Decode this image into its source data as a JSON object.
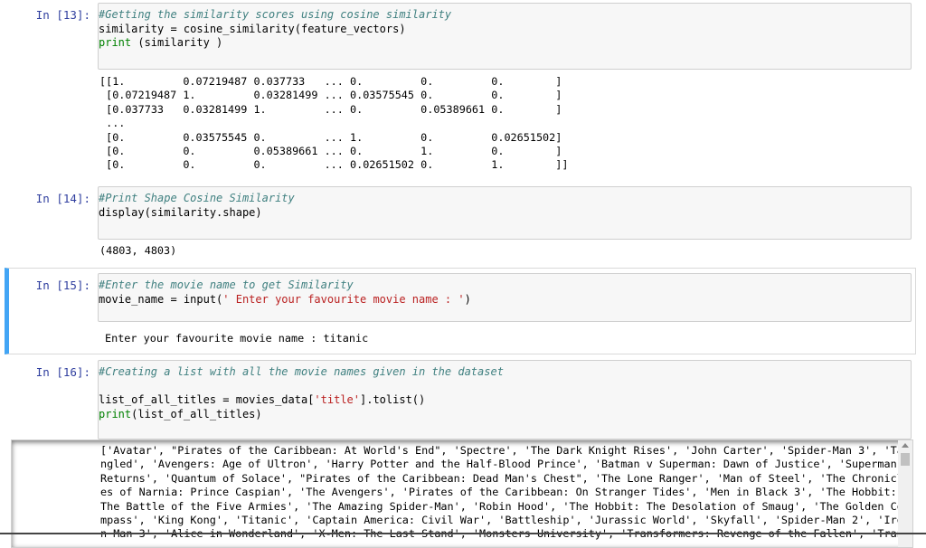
{
  "cells": [
    {
      "prompt": "In [13]:",
      "comment": "#Getting the similarity scores using cosine similarity",
      "line2": "similarity = cosine_similarity(feature_vectors)",
      "line3_kw": "print",
      "line3_rest": " (similarity )",
      "output": "[[1.         0.07219487 0.037733   ... 0.         0.         0.        ]\n [0.07219487 1.         0.03281499 ... 0.03575545 0.         0.        ]\n [0.037733   0.03281499 1.         ... 0.         0.05389661 0.        ]\n ...\n [0.         0.03575545 0.         ... 1.         0.         0.02651502]\n [0.         0.         0.05389661 ... 0.         1.         0.        ]\n [0.         0.         0.         ... 0.02651502 0.         1.        ]]"
    },
    {
      "prompt": "In [14]:",
      "comment": "#Print Shape Cosine Similarity",
      "line2": "display(similarity.shape)",
      "output": "(4803, 4803)"
    },
    {
      "prompt": "In [15]:",
      "comment": "#Enter the movie name to get Similarity",
      "line2_a": "movie_name = input(",
      "line2_str": "' Enter your favourite movie name : '",
      "line2_b": ")",
      "output": "Enter your favourite movie name : titanic"
    },
    {
      "prompt": "In [16]:",
      "comment": "#Creating a list with all the movie names given in the dataset",
      "line2_a": "list_of_all_titles = movies_data[",
      "line2_str": "'title'",
      "line2_b": "].tolist()",
      "line3_kw": "print",
      "line3_rest": "(list_of_all_titles)",
      "output": "['Avatar', \"Pirates of the Caribbean: At World's End\", 'Spectre', 'The Dark Knight Rises', 'John Carter', 'Spider-Man 3', 'Ta\nngled', 'Avengers: Age of Ultron', 'Harry Potter and the Half-Blood Prince', 'Batman v Superman: Dawn of Justice', 'Superman\nReturns', 'Quantum of Solace', \"Pirates of the Caribbean: Dead Man's Chest\", 'The Lone Ranger', 'Man of Steel', 'The Chronicl\nes of Narnia: Prince Caspian', 'The Avengers', 'Pirates of the Caribbean: On Stranger Tides', 'Men in Black 3', 'The Hobbit:\nThe Battle of the Five Armies', 'The Amazing Spider-Man', 'Robin Hood', 'The Hobbit: The Desolation of Smaug', 'The Golden Co\nmpass', 'King Kong', 'Titanic', 'Captain America: Civil War', 'Battleship', 'Jurassic World', 'Skyfall', 'Spider-Man 2', 'Iro\nn Man 3', 'Alice in Wonderland', 'X-Men: The Last Stand', 'Monsters University', 'Transformers: Revenge of the Fallen', 'Tran"
    }
  ],
  "colors": {
    "prompt": "#303f9f",
    "comment": "#408080",
    "keyword": "#008000",
    "string": "#ba2121",
    "operator": "#aa22ff",
    "selected_border": "#42a5f5"
  },
  "icons": [
    "scroll-up-icon"
  ]
}
